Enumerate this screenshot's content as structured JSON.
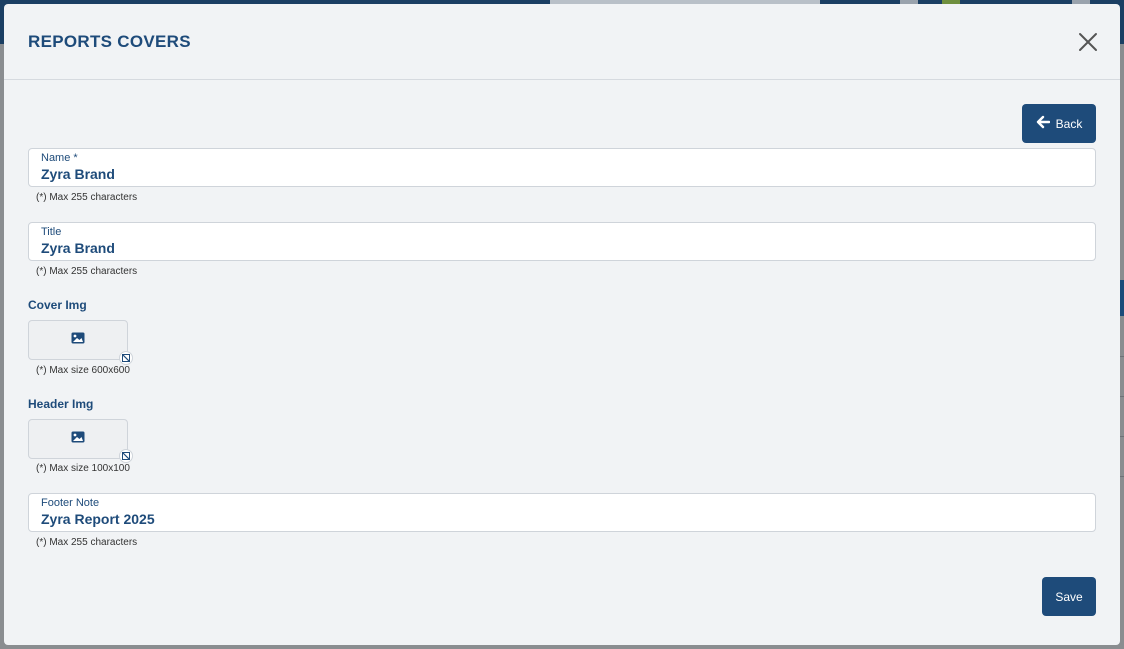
{
  "modal": {
    "title": "REPORTS COVERS",
    "close_icon": "close-icon",
    "back_label": "Back",
    "back_icon": "arrow-left-icon",
    "save_label": "Save"
  },
  "fields": {
    "name": {
      "label": "Name *",
      "value": "Zyra Brand",
      "hint": "(*) Max 255 characters"
    },
    "title": {
      "label": "Title",
      "value": "Zyra Brand",
      "hint": "(*) Max 255 characters"
    },
    "cover_img": {
      "label": "Cover Img",
      "hint": "(*) Max size 600x600",
      "icon": "image-icon"
    },
    "header_img": {
      "label": "Header Img",
      "hint": "(*) Max size 100x100",
      "icon": "image-icon"
    },
    "footer_note": {
      "label": "Footer Note",
      "value": "Zyra Report 2025",
      "hint": "(*) Max 255 characters"
    }
  },
  "colors": {
    "primary": "#1e4b7a",
    "modal_bg": "#f1f3f5",
    "overlay": "#8a8d90"
  }
}
